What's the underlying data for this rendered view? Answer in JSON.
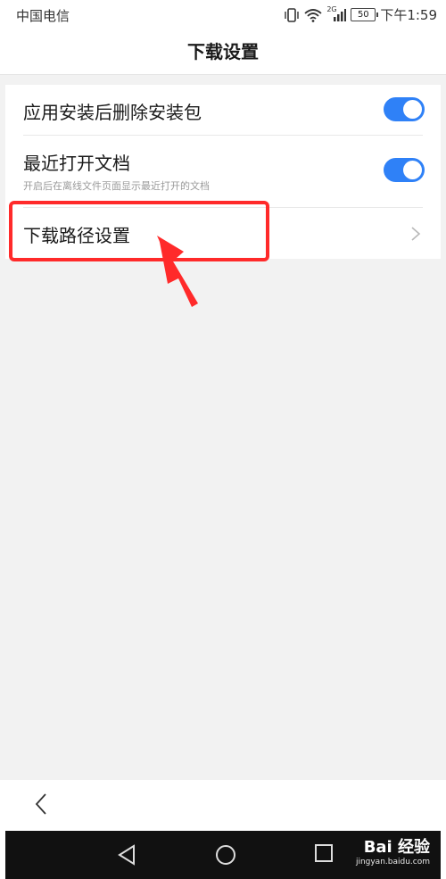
{
  "statusbar": {
    "carrier": "中国电信",
    "battery": "50",
    "network": "2G",
    "time": "下午1:59"
  },
  "header": {
    "title": "下载设置"
  },
  "settings": [
    {
      "label": "应用安装后删除安装包",
      "toggle": true
    },
    {
      "label": "最近打开文档",
      "subtitle": "开启后在离线文件页面显示最近打开的文档",
      "toggle": true
    },
    {
      "label": "下载路径设置",
      "chevron": "chevron-right-icon"
    }
  ],
  "annotation": {
    "color": "#ff2a2a"
  },
  "accent": "#2f81f7",
  "watermark": {
    "brand": "Bai 经验",
    "url": "jingyan.baidu.com"
  }
}
